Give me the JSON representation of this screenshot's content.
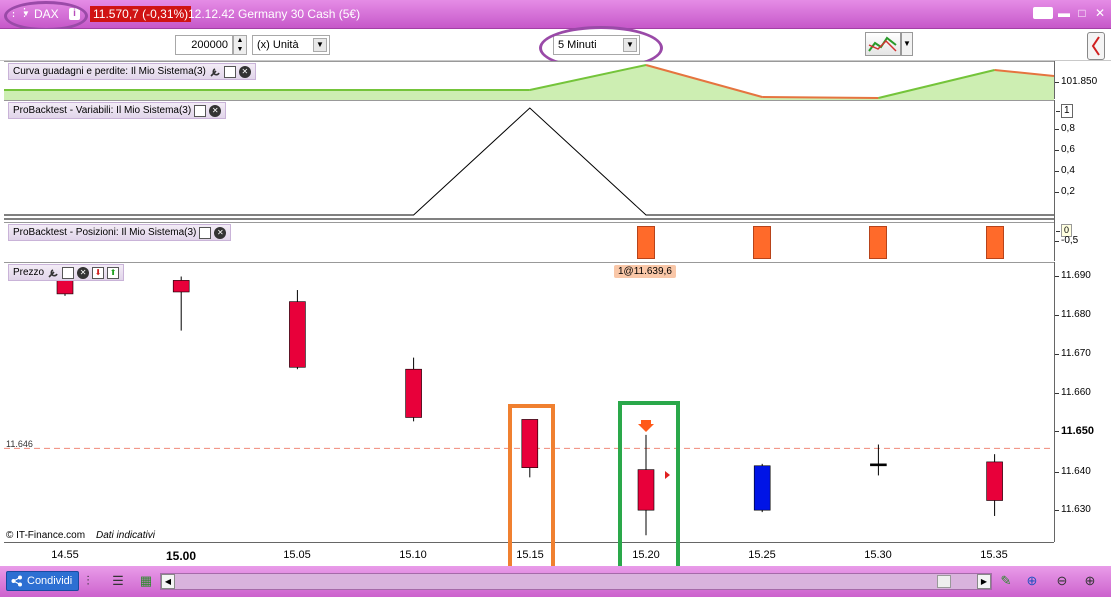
{
  "title_bar": {
    "symbol": "DAX",
    "info_glyph": "i",
    "price": "11.570,7 (-0,31%)",
    "description": "12.12.42 Germany 30 Cash (5€)",
    "icons": [
      "grip-icon",
      "chevron-down-icon",
      "info-icon",
      "keyboard-icon",
      "minimize-icon",
      "maximize-icon",
      "close-icon"
    ]
  },
  "toolbar": {
    "quantity": "200000",
    "unit": "(x) Unità",
    "timeframe": "5 Minuti"
  },
  "panels": {
    "equity": {
      "label": "Curva guadagni e perdite: Il Mio Sistema(3)",
      "axis_value": "101.850"
    },
    "variables": {
      "label": "ProBacktest - Variabili: Il Mio Sistema(3)",
      "ticks": [
        "1",
        "0,8",
        "0,6",
        "0,4",
        "0,2"
      ]
    },
    "positions": {
      "label": "ProBacktest - Posizioni: Il Mio Sistema(3)",
      "ticks": [
        "0",
        "-0,5"
      ]
    },
    "price": {
      "label": "Prezzo",
      "trade_tag": "1@11.639,6",
      "ref_level": "11.646",
      "copyright": "© IT-Finance.com",
      "disclaimer": "Dati indicativi",
      "ticks": [
        "11.690",
        "11.680",
        "11.670",
        "11.660",
        "11.650",
        "11.640",
        "11.630"
      ]
    }
  },
  "time_axis": [
    "14.55",
    "15.00",
    "15.05",
    "15.10",
    "15.15",
    "15.20",
    "15.25",
    "15.30",
    "15.35"
  ],
  "chart_data": {
    "type": "candlestick",
    "x": [
      "14.55",
      "15.00",
      "15.05",
      "15.10",
      "15.15",
      "15.20",
      "15.25",
      "15.30",
      "15.35"
    ],
    "candles": [
      {
        "t": "14.55",
        "open": 11692,
        "high": 11692,
        "low": 11685.5,
        "close": 11686,
        "color": "#e8003a"
      },
      {
        "t": "15.00",
        "open": 11689.5,
        "high": 11690.5,
        "low": 11676.5,
        "close": 11686.5,
        "color": "#e8003a"
      },
      {
        "t": "15.05",
        "open": 11684,
        "high": 11687,
        "low": 11666.5,
        "close": 11667,
        "color": "#e8003a"
      },
      {
        "t": "15.10",
        "open": 11666.5,
        "high": 11669.5,
        "low": 11653,
        "close": 11654,
        "color": "#e8003a"
      },
      {
        "t": "15.15",
        "open": 11653.5,
        "high": 11653.5,
        "low": 11638.5,
        "close": 11641,
        "color": "#e8003a"
      },
      {
        "t": "15.20",
        "open": 11640.5,
        "high": 11649.5,
        "low": 11623.5,
        "close": 11630,
        "color": "#e8003a"
      },
      {
        "t": "15.25",
        "open": 11630,
        "high": 11642,
        "low": 11629.5,
        "close": 11641.5,
        "color": "#0014e6"
      },
      {
        "t": "15.30",
        "open": 11642,
        "high": 11647,
        "low": 11639,
        "close": 11642,
        "color": "#000000"
      },
      {
        "t": "15.35",
        "open": 11642.5,
        "high": 11644.5,
        "low": 11628.5,
        "close": 11632.5,
        "color": "#e8003a"
      }
    ],
    "price_range": [
      11621.5,
      11694
    ],
    "variables_line": {
      "x": [
        "15.10",
        "15.15",
        "15.20",
        "15.35"
      ],
      "y": [
        0,
        1,
        0,
        0
      ],
      "range": [
        0,
        1
      ]
    },
    "position_bars_at": [
      "15.20",
      "15.25",
      "15.30",
      "15.35"
    ],
    "equity_curve": {
      "profit_color": "#74c43a",
      "loss_color": "#e5743f",
      "fill_color": "#cdeeb2"
    }
  },
  "annotations": {
    "orange_box": "15.15",
    "green_box": "15.20",
    "oval_color": "#9a4aa8",
    "orange_color": "#f08030",
    "green_color": "#2aa84a"
  },
  "bottom_bar": {
    "share_label": "Condividi"
  }
}
